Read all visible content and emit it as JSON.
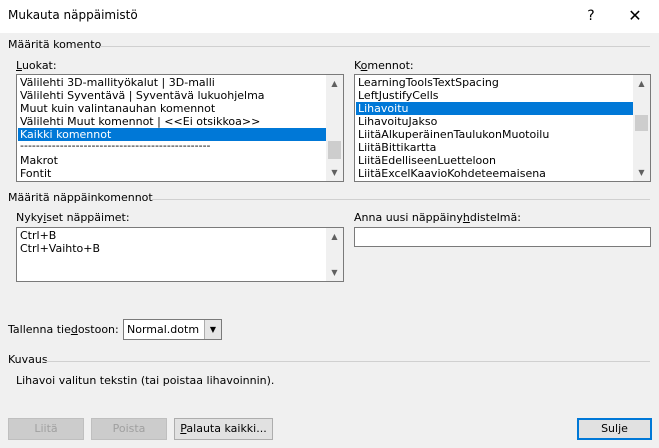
{
  "window": {
    "title": "Mukauta näppäimistö",
    "help": "?",
    "close": "✕"
  },
  "command_section": {
    "heading": "Määritä komento",
    "categories_label": "Luokat:",
    "categories": [
      "Välilehti 3D-mallityökalut | 3D-malli",
      "Välilehti Syventävä | Syventävä lukuohjelma",
      "Muut kuin valintanauhan komennot",
      "Välilehti Muut komennot | <<Ei otsikkoa>>",
      "Kaikki komennot",
      "------------------------------------------------",
      "Makrot",
      "Fontit"
    ],
    "categories_selected_index": 4,
    "commands_label": "Komennot:",
    "commands": [
      "LearningToolsTextSpacing",
      "LeftJustifyCells",
      "Lihavoitu",
      "LihavoituJakso",
      "LiitäAlkuperäinenTaulukonMuotoilu",
      "LiitäBittikartta",
      "LiitäEdelliseenLuetteloon",
      "LiitäExcelKaavioKohdeteemaisena"
    ],
    "commands_selected_index": 2
  },
  "keys_section": {
    "heading": "Määritä näppäinkomennot",
    "current_keys_label": "Nykyiset näppäimet:",
    "current_keys": [
      "Ctrl+B",
      "Ctrl+Vaihto+B"
    ],
    "new_key_label": "Anna uusi näppäinyhdistelmä:",
    "new_key_value": ""
  },
  "save_in": {
    "label": "Tallenna tiedostoon:",
    "value": "Normal.dotm"
  },
  "description": {
    "heading": "Kuvaus",
    "text": "Lihavoi valitun tekstin (tai poistaa lihavoinnin)."
  },
  "buttons": {
    "assign": "Liitä",
    "remove": "Poista",
    "reset_all": "Palauta kaikki...",
    "close": "Sulje"
  }
}
